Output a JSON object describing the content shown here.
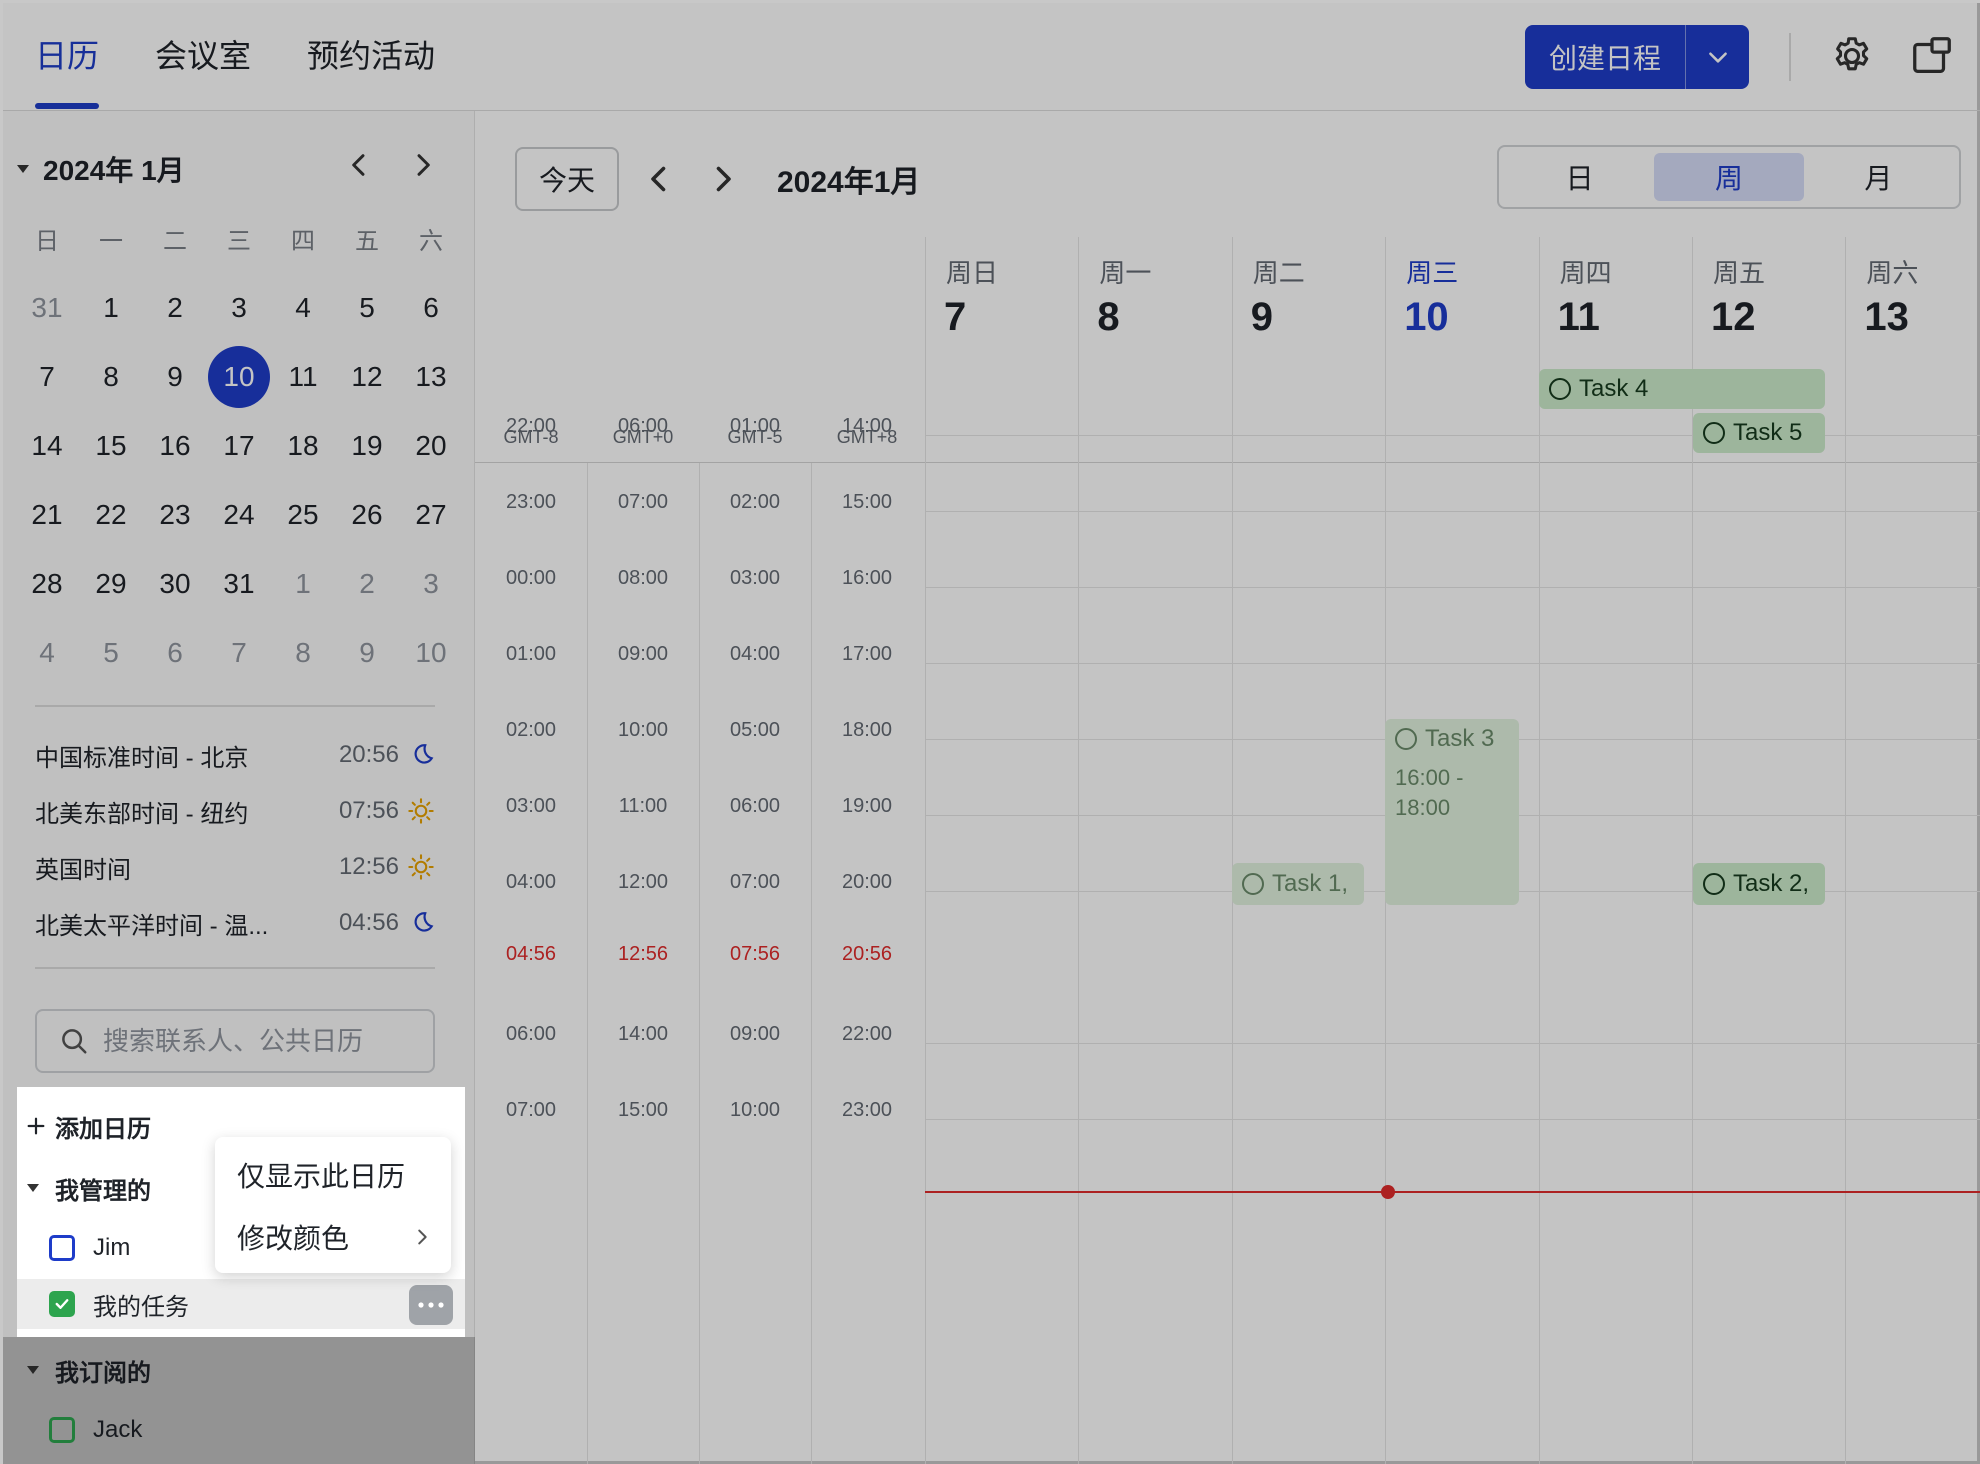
{
  "topbar": {
    "tabs": [
      "日历",
      "会议室",
      "预约活动"
    ],
    "create_label": "创建日程"
  },
  "mini_calendar": {
    "title": "2024年 1月",
    "weekdays": [
      "日",
      "一",
      "二",
      "三",
      "四",
      "五",
      "六"
    ],
    "days": [
      {
        "d": "31",
        "muted": true
      },
      {
        "d": "1"
      },
      {
        "d": "2"
      },
      {
        "d": "3"
      },
      {
        "d": "4"
      },
      {
        "d": "5"
      },
      {
        "d": "6"
      },
      {
        "d": "7"
      },
      {
        "d": "8"
      },
      {
        "d": "9"
      },
      {
        "d": "10",
        "today": true
      },
      {
        "d": "11"
      },
      {
        "d": "12"
      },
      {
        "d": "13"
      },
      {
        "d": "14"
      },
      {
        "d": "15"
      },
      {
        "d": "16"
      },
      {
        "d": "17"
      },
      {
        "d": "18"
      },
      {
        "d": "19"
      },
      {
        "d": "20"
      },
      {
        "d": "21"
      },
      {
        "d": "22"
      },
      {
        "d": "23"
      },
      {
        "d": "24"
      },
      {
        "d": "25"
      },
      {
        "d": "26"
      },
      {
        "d": "27"
      },
      {
        "d": "28"
      },
      {
        "d": "29"
      },
      {
        "d": "30"
      },
      {
        "d": "31"
      },
      {
        "d": "1",
        "muted": true
      },
      {
        "d": "2",
        "muted": true
      },
      {
        "d": "3",
        "muted": true
      },
      {
        "d": "4",
        "muted": true
      },
      {
        "d": "5",
        "muted": true
      },
      {
        "d": "6",
        "muted": true
      },
      {
        "d": "7",
        "muted": true
      },
      {
        "d": "8",
        "muted": true
      },
      {
        "d": "9",
        "muted": true
      },
      {
        "d": "10",
        "muted": true
      }
    ]
  },
  "timezones": [
    {
      "name": "中国标准时间 - 北京",
      "time": "20:56",
      "icon": "moon-icon"
    },
    {
      "name": "北美东部时间 - 纽约",
      "time": "07:56",
      "icon": "sun-icon"
    },
    {
      "name": "英国时间",
      "time": "12:56",
      "icon": "sun-icon"
    },
    {
      "name": "北美太平洋时间 - 温...",
      "time": "04:56",
      "icon": "moon-icon"
    }
  ],
  "search": {
    "placeholder": "搜索联系人、公共日历"
  },
  "calendar_list": {
    "add_label": "添加日历",
    "managed_label": "我管理的",
    "managed": [
      "Jim",
      "我的任务"
    ],
    "subscribed_label": "我订阅的",
    "subscribed": [
      "Jack"
    ]
  },
  "context_menu": {
    "items": [
      "仅显示此日历",
      "修改颜色"
    ]
  },
  "main": {
    "today_label": "今天",
    "title": "2024年1月",
    "views": [
      "日",
      "周",
      "月"
    ],
    "active_view": "周",
    "gmt_labels": [
      "GMT-8",
      "GMT+0",
      "GMT-5",
      "GMT+8"
    ],
    "days": [
      {
        "name": "周日",
        "num": "7"
      },
      {
        "name": "周一",
        "num": "8"
      },
      {
        "name": "周二",
        "num": "9"
      },
      {
        "name": "周三",
        "num": "10",
        "current": true
      },
      {
        "name": "周四",
        "num": "11"
      },
      {
        "name": "周五",
        "num": "12"
      },
      {
        "name": "周六",
        "num": "13"
      }
    ],
    "time_rows": [
      [
        "22:00",
        "06:00",
        "01:00",
        "14:00"
      ],
      [
        "23:00",
        "07:00",
        "02:00",
        "15:00"
      ],
      [
        "00:00",
        "08:00",
        "03:00",
        "16:00"
      ],
      [
        "01:00",
        "09:00",
        "04:00",
        "17:00"
      ],
      [
        "02:00",
        "10:00",
        "05:00",
        "18:00"
      ],
      [
        "03:00",
        "11:00",
        "06:00",
        "19:00"
      ],
      [
        "04:00",
        "12:00",
        "07:00",
        "20:00"
      ],
      [
        "04:56",
        "12:56",
        "07:56",
        "20:56"
      ],
      [
        "06:00",
        "14:00",
        "09:00",
        "22:00"
      ],
      [
        "07:00",
        "15:00",
        "10:00",
        "23:00"
      ]
    ],
    "events": {
      "task4": "Task 4",
      "task5": "Task 5",
      "task3_title": "Task 3",
      "task3_time": "16:00 - 18:00",
      "task1": "Task 1,",
      "task2": "Task 2,"
    }
  },
  "colors": {
    "accent": "#1e3cc9",
    "now_line": "#e02b2b",
    "task_green": "#2da44e"
  }
}
